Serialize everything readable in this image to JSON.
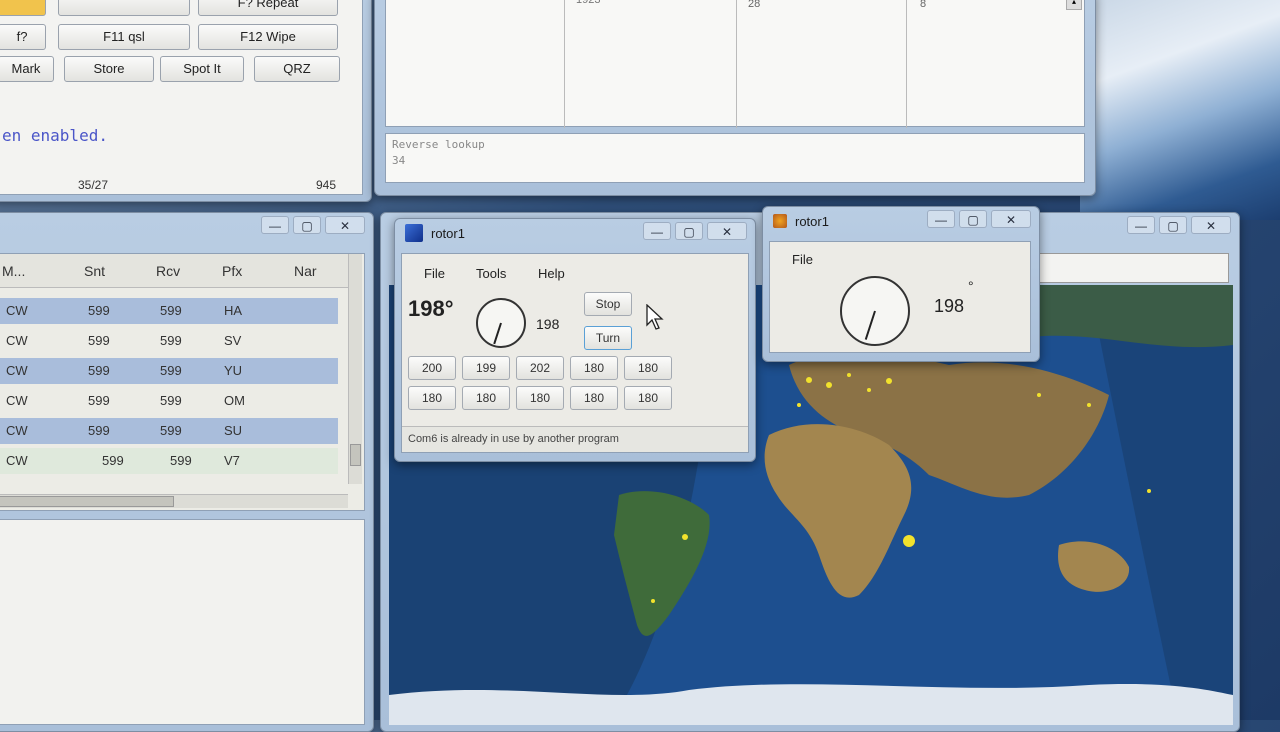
{
  "log_window": {
    "buttons_row0": [
      "",
      "",
      "F? Repeat"
    ],
    "buttons_row1": [
      "f?",
      "F11 qsl",
      "F12 Wipe"
    ],
    "buttons_row2": [
      "Mark",
      "Store",
      "Spot It",
      "QRZ"
    ],
    "message": "en enabled.",
    "counter_left": "35/27",
    "counter_right": "945"
  },
  "lookup_window": {
    "cells": [
      "1923",
      "28",
      "8"
    ],
    "reverse_label": "Reverse lookup",
    "reverse_value": "34"
  },
  "list_window": {
    "headers": [
      "M...",
      "Snt",
      "Rcv",
      "Pfx",
      "Nar"
    ],
    "rows": [
      {
        "mode": "CW",
        "snt": "599",
        "rcv": "599",
        "pfx": "HA"
      },
      {
        "mode": "CW",
        "snt": "599",
        "rcv": "599",
        "pfx": "SV"
      },
      {
        "mode": "CW",
        "snt": "599",
        "rcv": "599",
        "pfx": "YU"
      },
      {
        "mode": "CW",
        "snt": "599",
        "rcv": "599",
        "pfx": "OM"
      },
      {
        "mode": "CW",
        "snt": "599",
        "rcv": "599",
        "pfx": "SU"
      },
      {
        "mode": "CW",
        "snt": "599",
        "rcv": "599",
        "pfx": "V7"
      }
    ]
  },
  "rotor_main": {
    "title": "rotor1",
    "menu": [
      "File",
      "Tools",
      "Help"
    ],
    "heading": "198°",
    "dial_value": "198",
    "dial_angle_deg": 198,
    "stop_label": "Stop",
    "turn_label": "Turn",
    "presets_row1": [
      "200",
      "199",
      "202",
      "180",
      "180"
    ],
    "presets_row2": [
      "180",
      "180",
      "180",
      "180",
      "180"
    ],
    "status": "Com6 is already in use by another program"
  },
  "rotor_small": {
    "title": "rotor1",
    "menu": [
      "File"
    ],
    "value": "198",
    "degree": "°",
    "dial_angle_deg": 198
  },
  "window_controls": {
    "minimize": "—",
    "maximize": "▢",
    "close": "✕"
  },
  "colors": {
    "titlebar": "#b9cde3",
    "row_highlight": "#a9bddb",
    "ocean": "#1b4f8f",
    "land": "#9a7e4f"
  }
}
